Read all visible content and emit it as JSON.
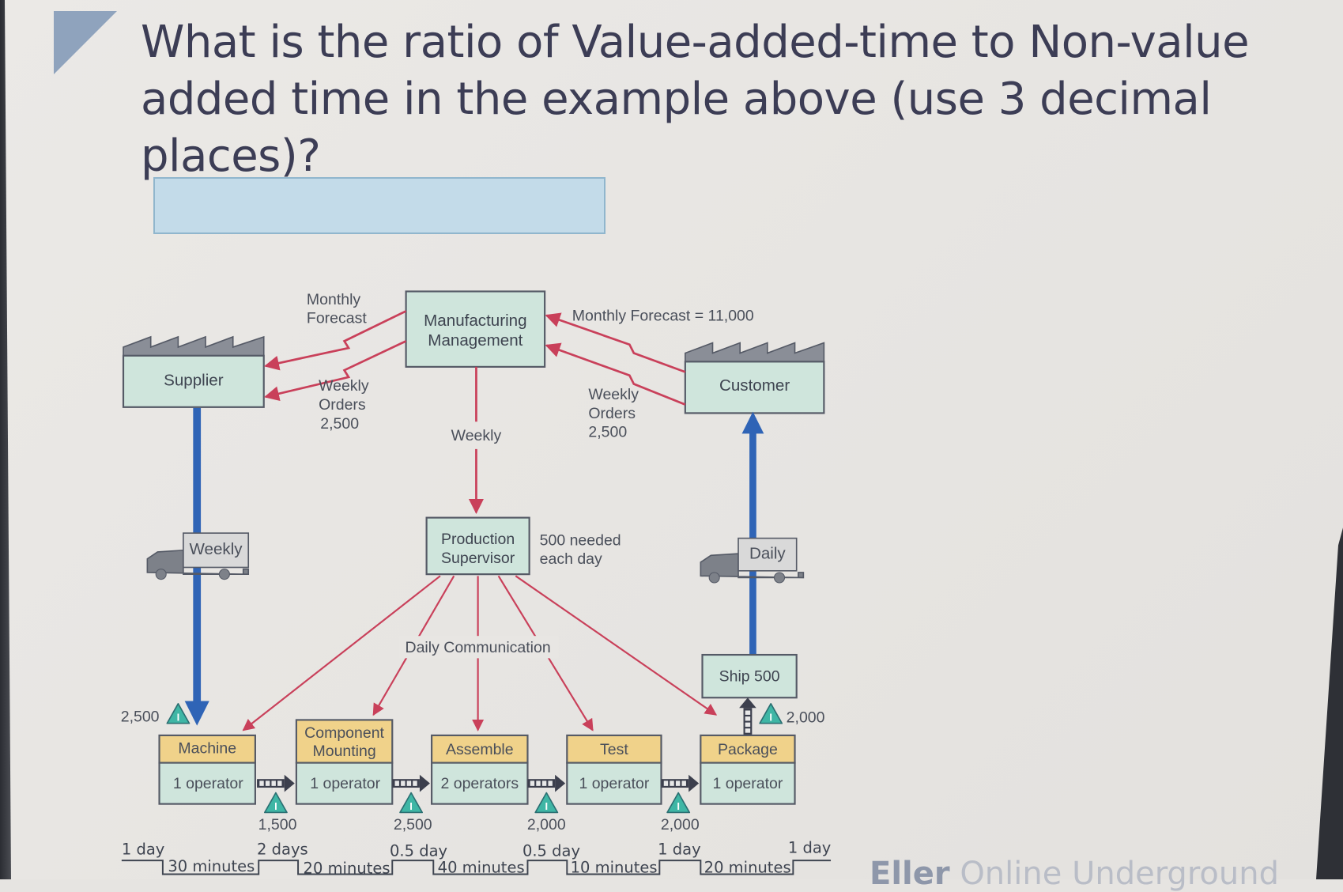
{
  "question": {
    "text": "What is the ratio of Value-added-time to Non-value added time in the example above (use 3 decimal places)?"
  },
  "answer_input": {
    "value": "",
    "placeholder": ""
  },
  "colors": {
    "info_box": "#cfe5dc",
    "process_header": "#f0d28a",
    "information_arrow": "#c9405a",
    "material_flow": "#2f64b6",
    "inventory_triangle": "#3fb6a5",
    "answer_box": "#c3dbe9"
  },
  "diagram": {
    "supplier": {
      "label": "Supplier",
      "icon": "factory-icon"
    },
    "customer": {
      "label": "Customer",
      "icon": "factory-icon"
    },
    "manufacturing_management": {
      "label_line1": "Manufacturing",
      "label_line2": "Management"
    },
    "production_supervisor": {
      "label_line1": "Production",
      "label_line2": "Supervisor"
    },
    "labels": {
      "monthly_forecast_line1": "Monthly",
      "monthly_forecast_line2": "Forecast",
      "weekly_orders_left_line1": "Weekly",
      "weekly_orders_left_line2": "Orders",
      "weekly_orders_left_line3": "2,500",
      "customer_forecast": "Monthly Forecast = 11,000",
      "weekly_orders_right_line1": "Weekly",
      "weekly_orders_right_line2": "Orders",
      "weekly_orders_right_line3": "2,500",
      "weekly_schedule": "Weekly",
      "needed_line1": "500 needed",
      "needed_line2": "each day",
      "daily_communication": "Daily Communication",
      "ship": "Ship 500"
    },
    "trucks": [
      {
        "label": "Weekly",
        "icon": "truck-icon"
      },
      {
        "label": "Daily",
        "icon": "truck-icon"
      }
    ],
    "processes": [
      {
        "name": "Machine",
        "name_line2": "",
        "operators": "1 operator"
      },
      {
        "name": "Component",
        "name_line2": "Mounting",
        "operators": "1 operator"
      },
      {
        "name": "Assemble",
        "name_line2": "",
        "operators": "2 operators"
      },
      {
        "name": "Test",
        "name_line2": "",
        "operators": "1 operator"
      },
      {
        "name": "Package",
        "name_line2": "",
        "operators": "1 operator"
      }
    ],
    "inventories": [
      {
        "qty": "2,500",
        "icon": "inventory-triangle-icon"
      },
      {
        "qty": "1,500",
        "icon": "inventory-triangle-icon"
      },
      {
        "qty": "2,500",
        "icon": "inventory-triangle-icon"
      },
      {
        "qty": "2,000",
        "icon": "inventory-triangle-icon"
      },
      {
        "qty": "2,000",
        "icon": "inventory-triangle-icon"
      },
      {
        "qty": "2,000",
        "icon": "inventory-triangle-icon"
      }
    ],
    "timeline": {
      "wait_times": [
        "1 day",
        "2 days",
        "0.5 day",
        "0.5 day",
        "1 day",
        "1 day"
      ],
      "process_times": [
        "30 minutes",
        "20 minutes",
        "40 minutes",
        "10 minutes",
        "20 minutes"
      ]
    }
  },
  "footer": {
    "brand_bold": "Eller",
    "brand_rest": " Online Underground"
  }
}
